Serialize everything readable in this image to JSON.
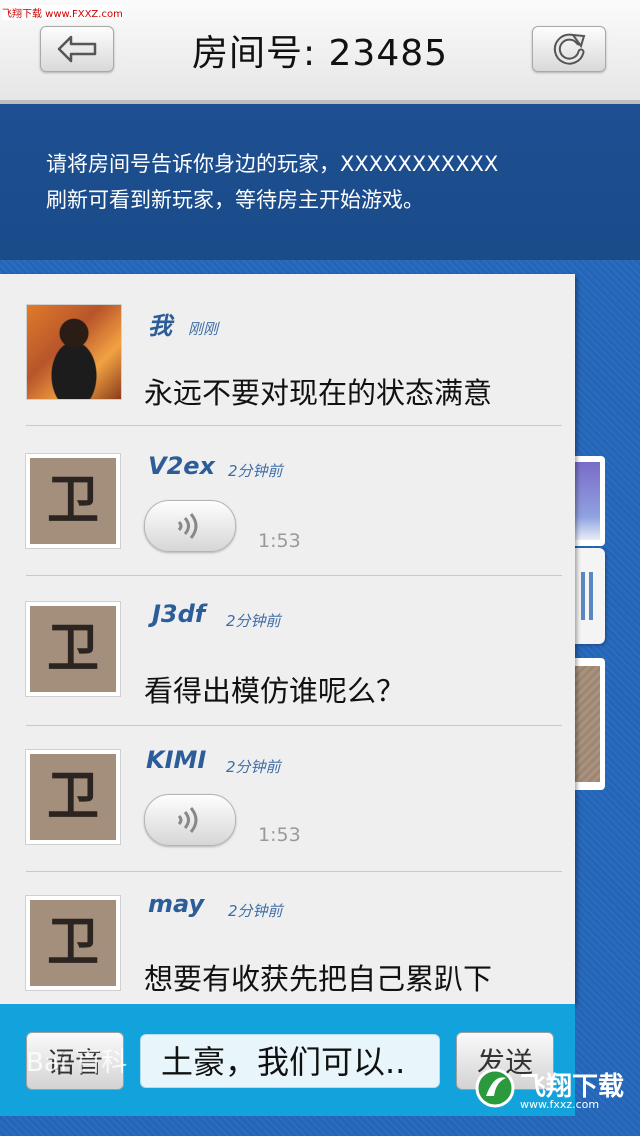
{
  "watermark_top": "飞翔下载 www.FXXZ.com",
  "header": {
    "room_label": "房间号:",
    "room_number": "23485"
  },
  "notice": {
    "line1": "请将房间号告诉你身边的玩家，XXXXXXXXXXX",
    "line2": "刷新可看到新玩家，等待房主开始游戏。"
  },
  "messages": [
    {
      "name": "我",
      "time": "刚刚",
      "type": "text",
      "text": "永远不要对现在的状态满意"
    },
    {
      "name": "V2ex",
      "time": "2分钟前",
      "type": "voice",
      "duration": "1:53"
    },
    {
      "name": "J3df",
      "time": "2分钟前",
      "type": "text",
      "text": "看得出模仿谁呢么？"
    },
    {
      "name": "KIMI",
      "time": "2分钟前",
      "type": "voice",
      "duration": "1:53"
    },
    {
      "name": "may",
      "time": "2分钟前",
      "type": "text",
      "text": "想要有收获先把自己累趴下"
    }
  ],
  "input_bar": {
    "voice_label": "语音",
    "input_value": "土豪，我们可以..",
    "send_label": "发送"
  },
  "watermarks": {
    "baidu": "Bai 百科",
    "logo_text": "飞翔下载",
    "logo_url": "www.fxxz.com"
  },
  "icons": {
    "back": "back-arrow-icon",
    "refresh": "refresh-icon",
    "voice": "sound-wave-icon"
  }
}
